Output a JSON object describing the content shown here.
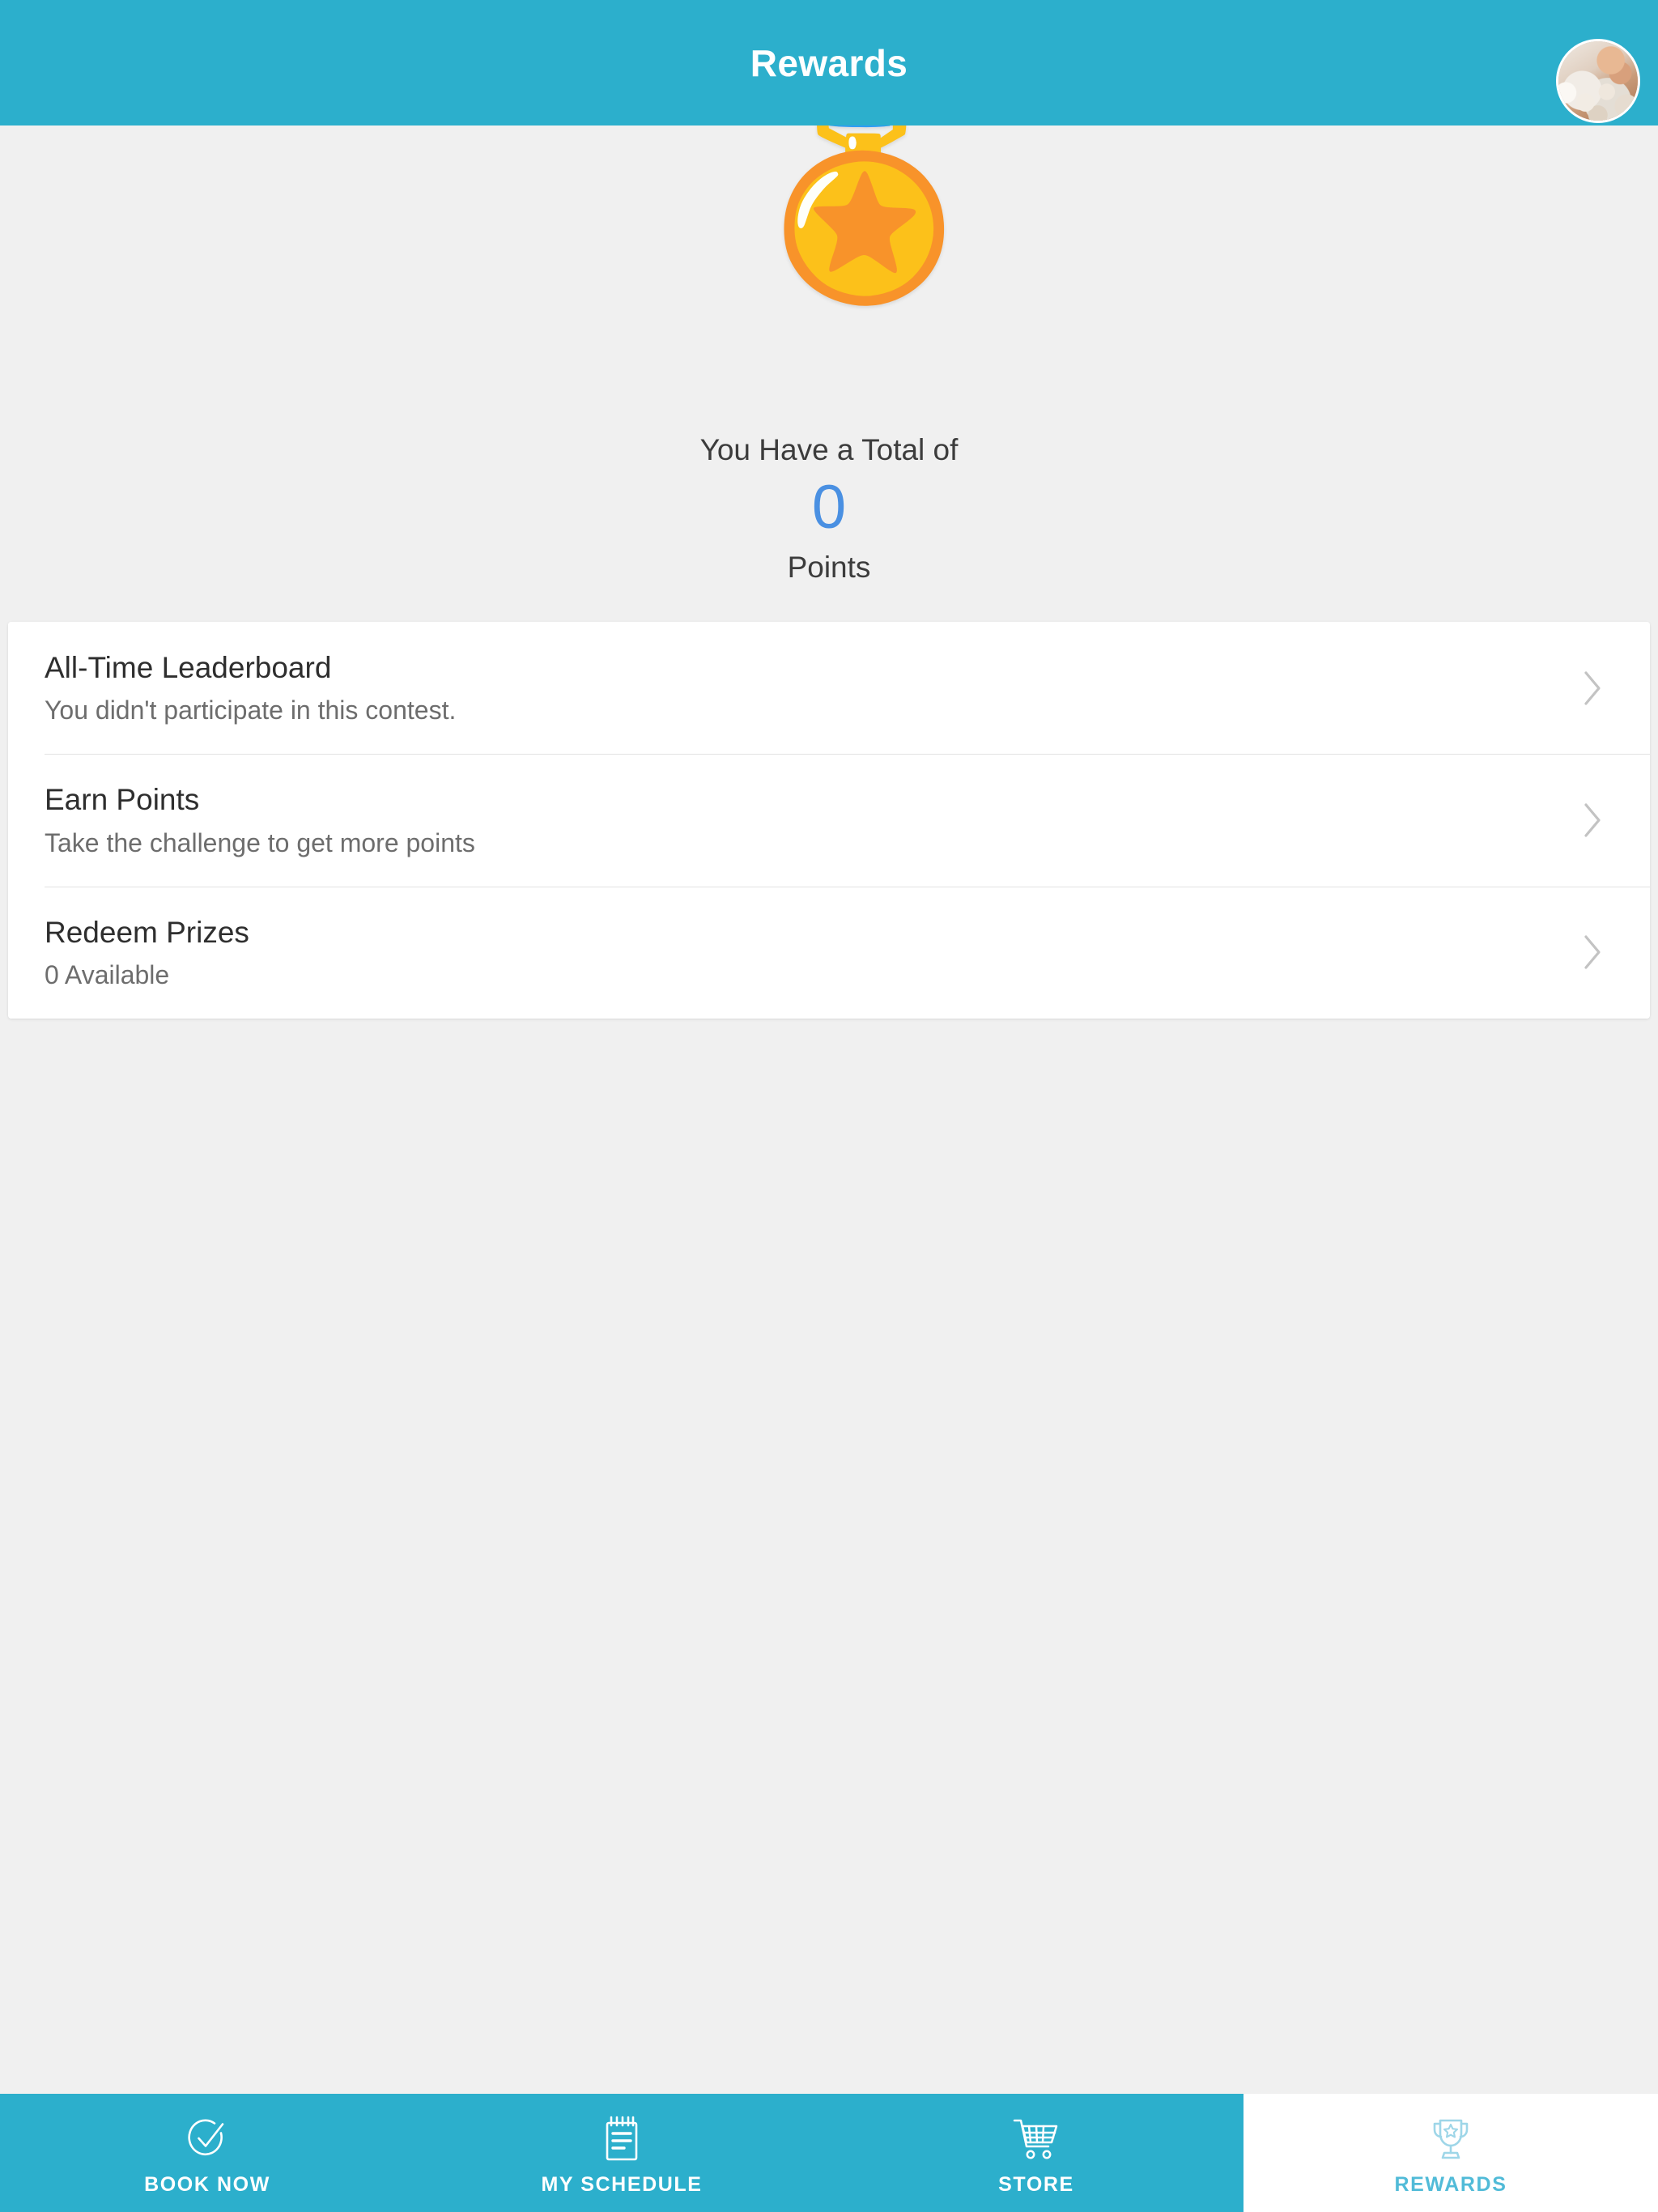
{
  "header": {
    "title": "Rewards",
    "bg_color": "#2CAFCC",
    "title_color": "#ffffff",
    "avatar_icon": "user-avatar-photo"
  },
  "hero": {
    "medal_icon": "gold-medal",
    "medal_glyph": "🏅",
    "total_label": "You Have a Total of",
    "points_value": "0",
    "points_value_color": "#4A90E2",
    "points_label": "Points"
  },
  "list": {
    "chevron_icon": "chevron-right-icon",
    "rows": [
      {
        "title": "All-Time Leaderboard",
        "subtitle": "You didn't participate in this contest."
      },
      {
        "title": "Earn Points",
        "subtitle": "Take the challenge to get more points"
      },
      {
        "title": "Redeem Prizes",
        "subtitle": "0 Available"
      }
    ]
  },
  "bottom_nav": {
    "active_color": "#51BBD8",
    "inactive_color": "#ffffff",
    "bg_color": "#2CAFCC",
    "tabs": [
      {
        "label": "BOOK NOW",
        "icon": "check-circle-icon",
        "active": false
      },
      {
        "label": "MY SCHEDULE",
        "icon": "notepad-icon",
        "active": false
      },
      {
        "label": "STORE",
        "icon": "shopping-cart-icon",
        "active": false
      },
      {
        "label": "REWARDS",
        "icon": "trophy-icon",
        "active": true
      }
    ]
  }
}
